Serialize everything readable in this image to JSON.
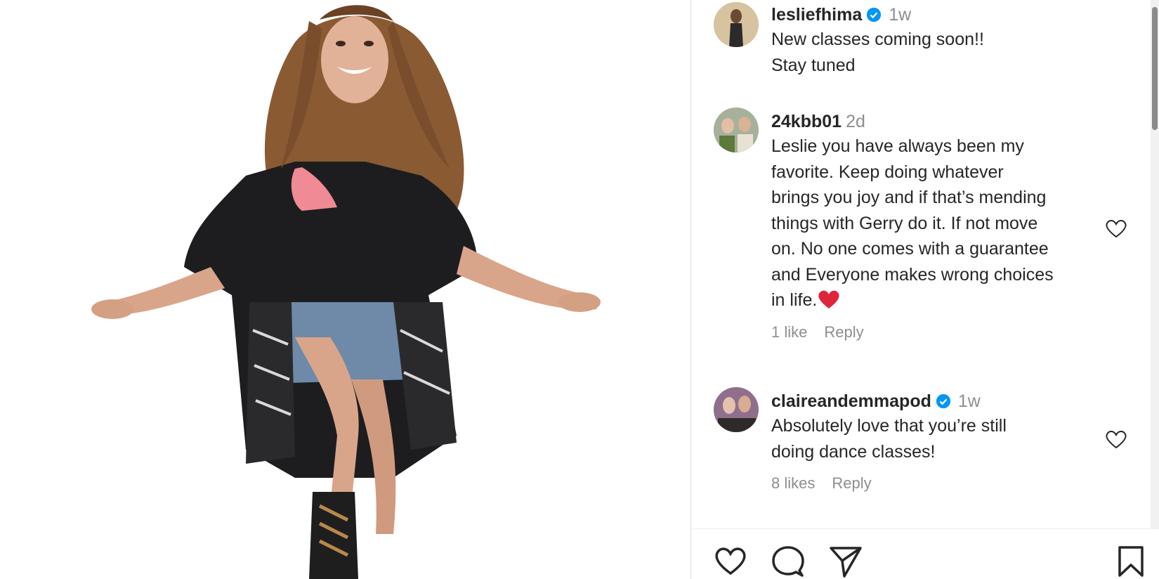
{
  "post": {
    "author": "lesliefhima",
    "verified": true,
    "time": "1w",
    "caption_line1": "New classes coming soon!!",
    "caption_line2": "Stay tuned"
  },
  "comments": [
    {
      "username": "24kbb01",
      "verified": false,
      "time": "2d",
      "lines": [
        "Leslie you have always been my",
        "favorite. Keep doing whatever",
        "brings you joy and if that’s mending",
        "things with Gerry do it. If not move",
        "on. No one comes with a guarantee",
        "and Everyone makes wrong choices",
        "in life."
      ],
      "likes": "1 like",
      "reply": "Reply"
    },
    {
      "username": "claireandemmapod",
      "verified": true,
      "time": "1w",
      "lines": [
        "Absolutely love that you’re still",
        "doing dance classes!"
      ],
      "likes": "8 likes",
      "reply": "Reply"
    }
  ],
  "icons": {
    "verified": "verified-badge-icon",
    "comment_like": "heart-outline-icon",
    "like": "heart-outline-icon",
    "comment": "comment-bubble-icon",
    "share": "paper-plane-icon",
    "save": "bookmark-icon",
    "emoji": "red-heart-emoji"
  },
  "colors": {
    "verified": "#0095f6",
    "text": "#262626",
    "muted": "#8e8e8e",
    "heart_emoji": "#e0243a"
  }
}
